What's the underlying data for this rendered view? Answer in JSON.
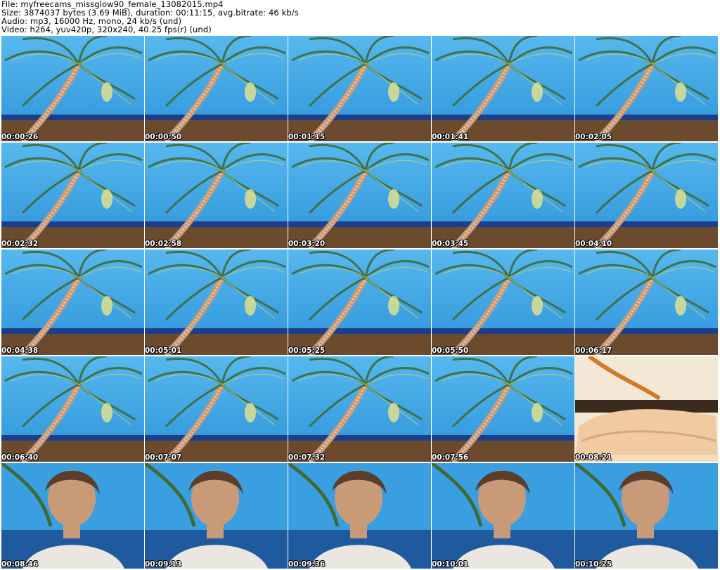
{
  "header": {
    "file": "File: myfreecams_missglow90_female_13082015.mp4",
    "size": "Size: 3874037 bytes (3.69 MiB), duration: 00:11:15, avg.bitrate: 46 kb/s",
    "audio": "Audio: mp3, 16000 Hz, mono, 24 kb/s (und)",
    "video": "Video: h264, yuv420p, 320x240, 40.25 fps(r) (und)"
  },
  "frames": [
    {
      "timestamp": "00:00:26",
      "scene": "palm"
    },
    {
      "timestamp": "00:00:50",
      "scene": "palm"
    },
    {
      "timestamp": "00:01:15",
      "scene": "palm"
    },
    {
      "timestamp": "00:01:41",
      "scene": "palm"
    },
    {
      "timestamp": "00:02:05",
      "scene": "palm"
    },
    {
      "timestamp": "00:02:32",
      "scene": "palm"
    },
    {
      "timestamp": "00:02:58",
      "scene": "palm"
    },
    {
      "timestamp": "00:03:20",
      "scene": "palm"
    },
    {
      "timestamp": "00:03:45",
      "scene": "palm"
    },
    {
      "timestamp": "00:04:10",
      "scene": "palm"
    },
    {
      "timestamp": "00:04:38",
      "scene": "palm"
    },
    {
      "timestamp": "00:05:01",
      "scene": "palm"
    },
    {
      "timestamp": "00:05:25",
      "scene": "palm"
    },
    {
      "timestamp": "00:05:50",
      "scene": "palm"
    },
    {
      "timestamp": "00:06:17",
      "scene": "palm"
    },
    {
      "timestamp": "00:06:40",
      "scene": "palm"
    },
    {
      "timestamp": "00:07:07",
      "scene": "palm"
    },
    {
      "timestamp": "00:07:32",
      "scene": "palm"
    },
    {
      "timestamp": "00:07:56",
      "scene": "palm"
    },
    {
      "timestamp": "00:08:21",
      "scene": "bed"
    },
    {
      "timestamp": "00:08:46",
      "scene": "person"
    },
    {
      "timestamp": "00:09:13",
      "scene": "person"
    },
    {
      "timestamp": "00:09:36",
      "scene": "person"
    },
    {
      "timestamp": "00:10:01",
      "scene": "person"
    },
    {
      "timestamp": "00:10:25",
      "scene": "person"
    }
  ]
}
